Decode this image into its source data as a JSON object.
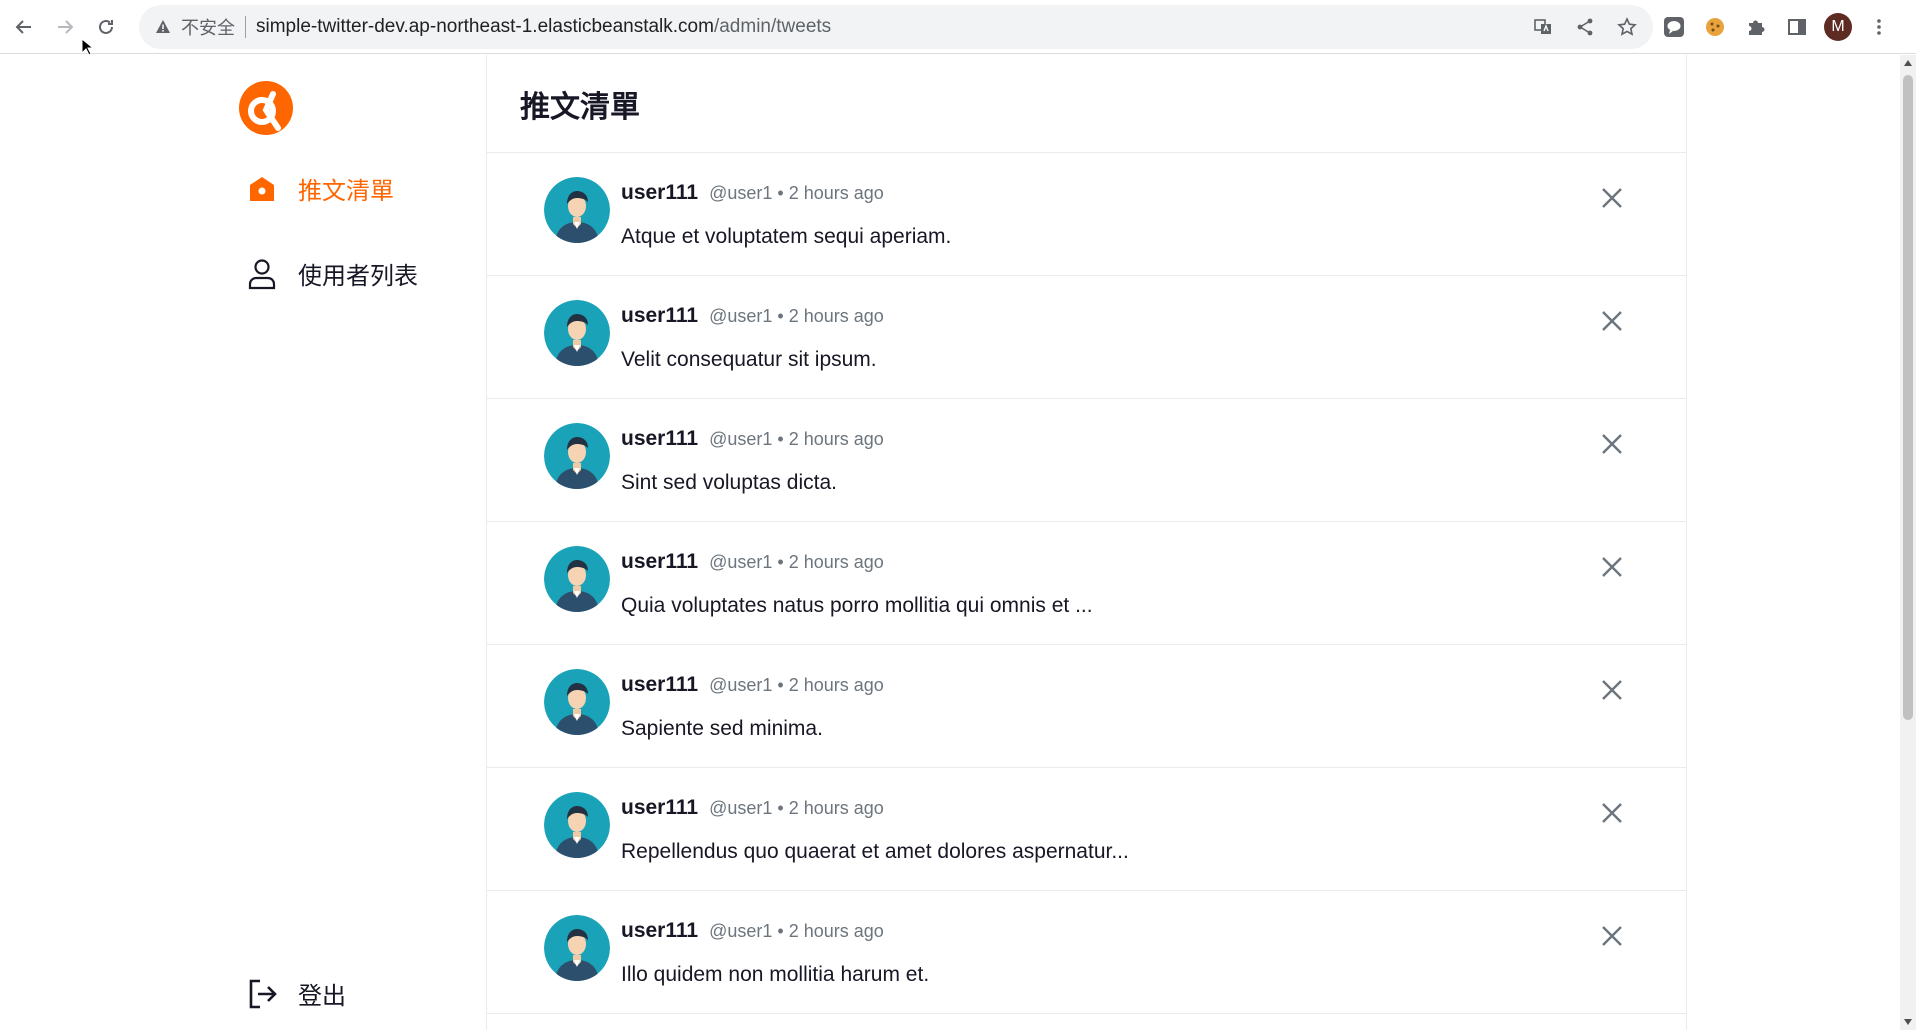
{
  "browser": {
    "insecure_label": "不安全",
    "url_host": "simple-twitter-dev.ap-northeast-1.elasticbeanstalk.com",
    "url_path": "/admin/tweets",
    "profile_initial": "M"
  },
  "sidebar": {
    "items": [
      {
        "label": "推文清單",
        "icon": "home-icon",
        "active": true
      },
      {
        "label": "使用者列表",
        "icon": "user-icon",
        "active": false
      }
    ],
    "logout_label": "登出",
    "brand_color": "#ff6600"
  },
  "main": {
    "title": "推文清單",
    "tweets": [
      {
        "name": "user111",
        "account": "@user1",
        "dot": "•",
        "time": "2 hours ago",
        "content": "Atque et voluptatem sequi aperiam."
      },
      {
        "name": "user111",
        "account": "@user1",
        "dot": "•",
        "time": "2 hours ago",
        "content": "Velit consequatur sit ipsum."
      },
      {
        "name": "user111",
        "account": "@user1",
        "dot": "•",
        "time": "2 hours ago",
        "content": "Sint sed voluptas dicta."
      },
      {
        "name": "user111",
        "account": "@user1",
        "dot": "•",
        "time": "2 hours ago",
        "content": "Quia voluptates natus porro mollitia qui omnis et ..."
      },
      {
        "name": "user111",
        "account": "@user1",
        "dot": "•",
        "time": "2 hours ago",
        "content": "Sapiente sed minima."
      },
      {
        "name": "user111",
        "account": "@user1",
        "dot": "•",
        "time": "2 hours ago",
        "content": "Repellendus quo quaerat et amet dolores aspernatur..."
      },
      {
        "name": "user111",
        "account": "@user1",
        "dot": "•",
        "time": "2 hours ago",
        "content": "Illo quidem non mollitia harum et."
      }
    ]
  }
}
